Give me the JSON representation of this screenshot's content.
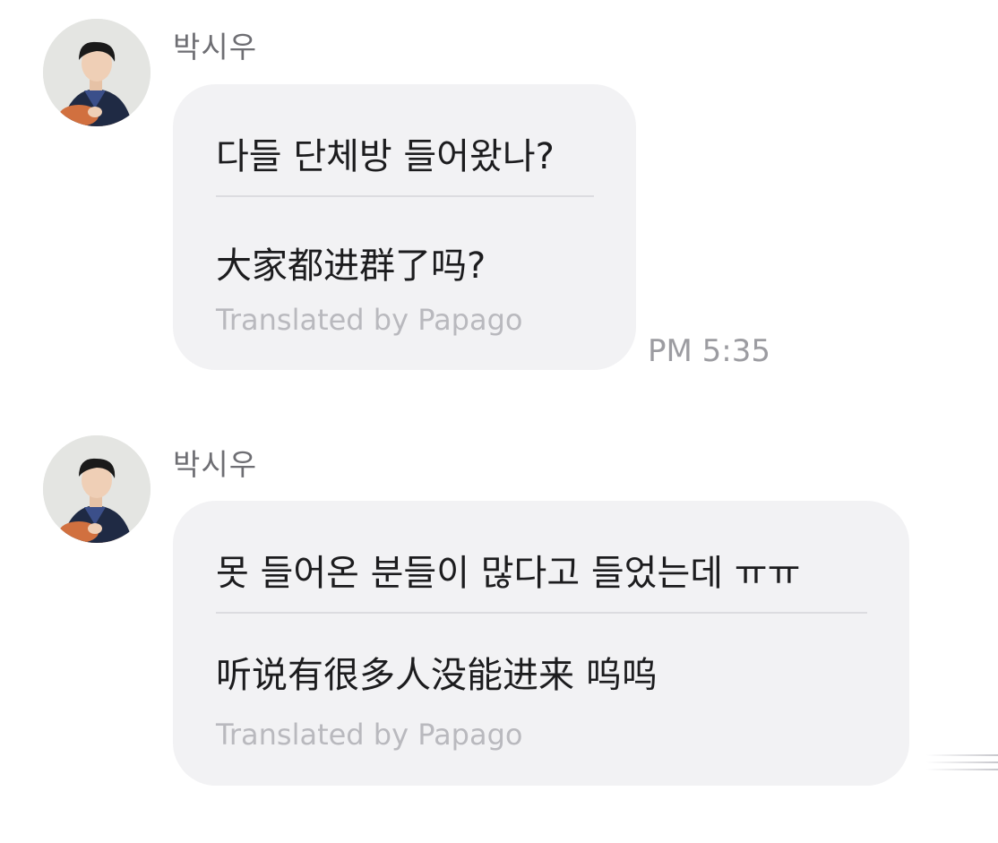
{
  "messages": [
    {
      "sender": "박시우",
      "avatar_icon": "profile-photo",
      "original": "다들 단체방 들어왔나?",
      "translated": "大家都进群了吗?",
      "credit": "Translated by Papago",
      "time": "PM 5:35"
    },
    {
      "sender": "박시우",
      "avatar_icon": "profile-photo",
      "original": "못 들어온 분들이 많다고 들었는데 ㅠㅠ",
      "translated": "听说有很多人没能进来 呜呜",
      "credit": "Translated by Papago",
      "time": ""
    }
  ],
  "colors": {
    "bubble": "#f2f2f4",
    "text": "#1c1c1e",
    "sender": "#6e6e73",
    "credit": "#b9b9be",
    "time": "#9c9ca1"
  }
}
